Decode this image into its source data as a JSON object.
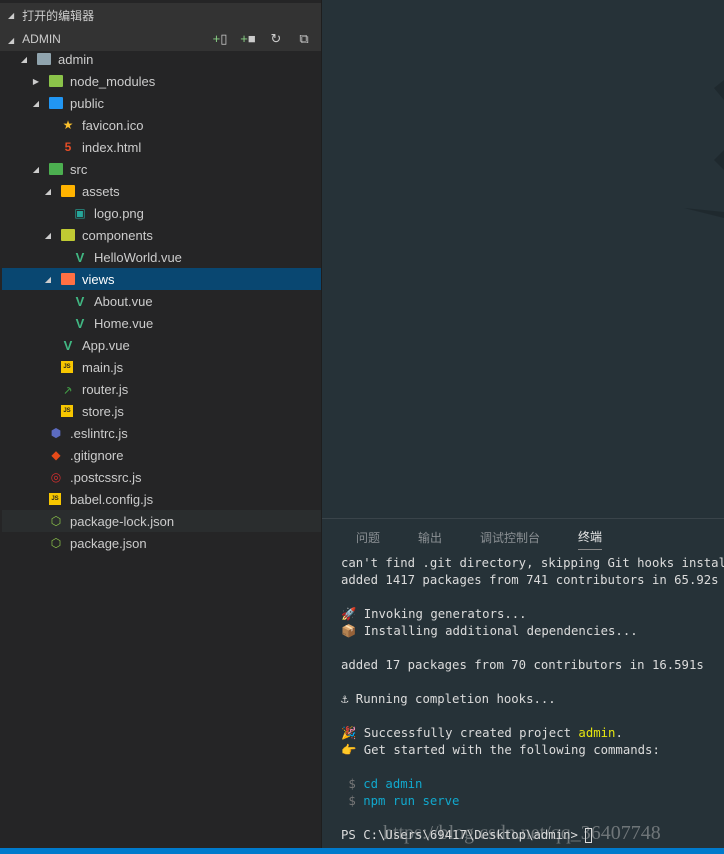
{
  "sidebar": {
    "open_editors": "打开的编辑器",
    "workspace": "ADMIN",
    "actions": [
      "new-file",
      "new-folder",
      "refresh",
      "collapse-all"
    ],
    "tree": [
      {
        "label": "admin",
        "level": 0,
        "type": "folder",
        "open": true,
        "icon_color": "#90a4ae"
      },
      {
        "label": "node_modules",
        "level": 1,
        "type": "folder",
        "open": false,
        "icon_color": "#8bc34a"
      },
      {
        "label": "public",
        "level": 1,
        "type": "folder",
        "open": true,
        "icon_color": "#2196f3"
      },
      {
        "label": "favicon.ico",
        "level": 2,
        "type": "file",
        "icon": "star",
        "icon_color": "#fbc02d"
      },
      {
        "label": "index.html",
        "level": 2,
        "type": "file",
        "icon": "html5",
        "icon_color": "#e44d26"
      },
      {
        "label": "src",
        "level": 1,
        "type": "folder",
        "open": true,
        "icon_color": "#4caf50"
      },
      {
        "label": "assets",
        "level": 2,
        "type": "folder",
        "open": true,
        "icon_color": "#ffb300"
      },
      {
        "label": "logo.png",
        "level": 3,
        "type": "file",
        "icon": "image",
        "icon_color": "#26a69a"
      },
      {
        "label": "components",
        "level": 2,
        "type": "folder",
        "open": true,
        "icon_color": "#c0ca33"
      },
      {
        "label": "HelloWorld.vue",
        "level": 3,
        "type": "file",
        "icon": "vue",
        "icon_color": "#41b883"
      },
      {
        "label": "views",
        "level": 2,
        "type": "folder",
        "open": true,
        "icon_color": "#ff7043",
        "selected": true
      },
      {
        "label": "About.vue",
        "level": 3,
        "type": "file",
        "icon": "vue",
        "icon_color": "#41b883"
      },
      {
        "label": "Home.vue",
        "level": 3,
        "type": "file",
        "icon": "vue",
        "icon_color": "#41b883"
      },
      {
        "label": "App.vue",
        "level": 2,
        "type": "file",
        "icon": "vue",
        "icon_color": "#41b883"
      },
      {
        "label": "main.js",
        "level": 2,
        "type": "file",
        "icon": "js",
        "icon_color": "#f7c600"
      },
      {
        "label": "router.js",
        "level": 2,
        "type": "file",
        "icon": "router",
        "icon_color": "#43a047"
      },
      {
        "label": "store.js",
        "level": 2,
        "type": "file",
        "icon": "js",
        "icon_color": "#f7c600"
      },
      {
        "label": ".eslintrc.js",
        "level": 1,
        "type": "file",
        "icon": "eslint",
        "icon_color": "#5c6bc0"
      },
      {
        "label": ".gitignore",
        "level": 1,
        "type": "file",
        "icon": "git",
        "icon_color": "#e64a19"
      },
      {
        "label": ".postcssrc.js",
        "level": 1,
        "type": "file",
        "icon": "postcss",
        "icon_color": "#d32f2f"
      },
      {
        "label": "babel.config.js",
        "level": 1,
        "type": "file",
        "icon": "js",
        "icon_color": "#f7c600"
      },
      {
        "label": "package-lock.json",
        "level": 1,
        "type": "file",
        "icon": "nodejs",
        "icon_color": "#8bc34a",
        "hover": true
      },
      {
        "label": "package.json",
        "level": 1,
        "type": "file",
        "icon": "nodejs",
        "icon_color": "#8bc34a"
      }
    ]
  },
  "panel": {
    "tabs": [
      "问题",
      "输出",
      "调试控制台",
      "终端"
    ],
    "active_tab": "终端",
    "terminal": {
      "line1": "can't find .git directory, skipping Git hooks installation",
      "line2": "added 1417 packages from 741 contributors in 65.92s",
      "rocket": "🚀",
      "line3": " Invoking generators...",
      "pkg": "📦",
      "line4": " Installing additional dependencies...",
      "line5": "added 17 packages from 70 contributors in 16.591s",
      "anchor": "⚓",
      "line6": " Running completion hooks...",
      "party": "🎉",
      "line7a": " Successfully created project ",
      "project": "admin",
      "line7b": ".",
      "point": "👉",
      "line8": " Get started with the following commands:",
      "dollar": " $ ",
      "cmd1": "cd admin",
      "cmd2": "npm run serve",
      "prompt": "PS C:\\Users\\69417\\Desktop\\admin> "
    }
  },
  "watermark": "https://blog.csdn.net/qq_36407748"
}
